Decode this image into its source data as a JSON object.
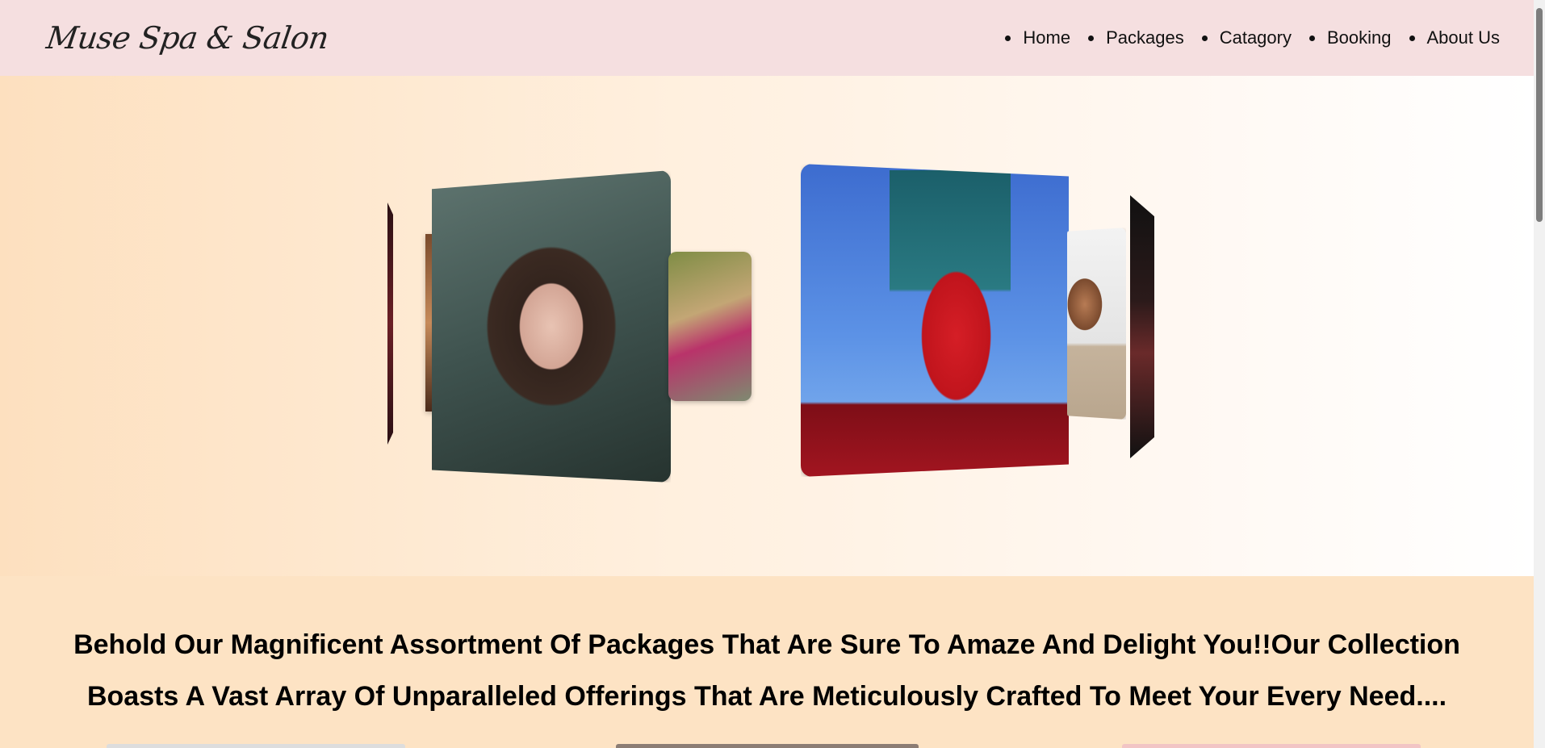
{
  "brand": {
    "name": "Muse Spa & Salon"
  },
  "nav": {
    "items": [
      {
        "label": "Home"
      },
      {
        "label": "Packages"
      },
      {
        "label": "Catagory"
      },
      {
        "label": "Booking"
      },
      {
        "label": "About Us"
      }
    ]
  },
  "hero": {
    "carousel_images": [
      "portrait-dark-red-edge",
      "portrait-woman-green-fur-hood",
      "spa-treatment-woman-lying",
      "woman-red-outfit-teal-scarf-blue-sky",
      "portrait-curly-hair-woman",
      "portrait-dark-edge"
    ]
  },
  "tagline": {
    "text": "Behold Our Magnificent Assortment Of Packages That Are Sure To Amaze And Delight You!!Our Collection Boasts A Vast Array Of Unparalleled Offerings That Are Meticulously Crafted To Meet Your Every Need...."
  },
  "colors": {
    "navbar_bg": "#f5dfe0",
    "page_bg": "#fde3c4",
    "text": "#000000"
  }
}
